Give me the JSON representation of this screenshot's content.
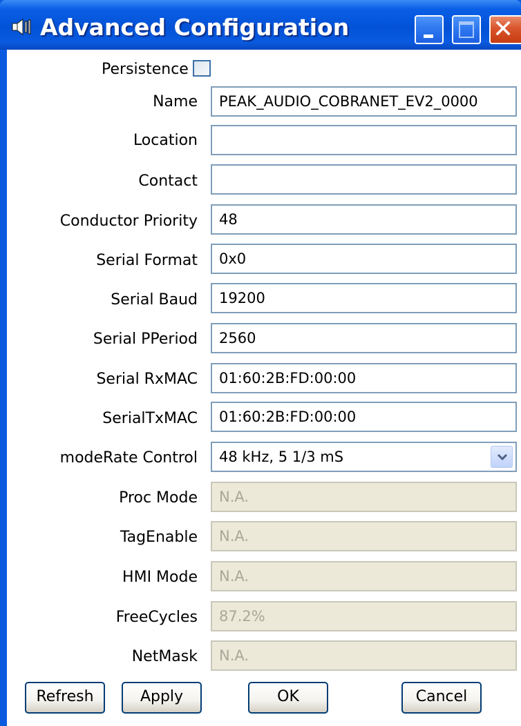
{
  "window": {
    "title": "Advanced Configuration",
    "title_icon": "speaker-icon"
  },
  "titlebar_buttons": {
    "minimize_icon": "minimize-icon",
    "maximize_icon": "maximize-icon",
    "close_icon": "close-icon"
  },
  "persistence": {
    "label": "Persistence",
    "checked": false
  },
  "fields": {
    "name": {
      "label": "Name",
      "value": "PEAK_AUDIO_COBRANET_EV2_0000"
    },
    "location": {
      "label": "Location",
      "value": ""
    },
    "contact": {
      "label": "Contact",
      "value": ""
    },
    "conductor_priority": {
      "label": "Conductor Priority",
      "value": "48"
    },
    "serial_format": {
      "label": "Serial Format",
      "value": "0x0"
    },
    "serial_baud": {
      "label": "Serial Baud",
      "value": "19200"
    },
    "serial_pperiod": {
      "label": "Serial PPeriod",
      "value": "2560"
    },
    "serial_rxmac": {
      "label": "Serial RxMAC",
      "value": "01:60:2B:FD:00:00"
    },
    "serial_txmac": {
      "label": "SerialTxMAC",
      "value": "01:60:2B:FD:00:00"
    },
    "moderate_control": {
      "label": "modeRate Control",
      "value": "48 kHz, 5 1/3 mS",
      "icon": "chevron-down-icon"
    },
    "proc_mode": {
      "label": "Proc Mode",
      "value": "N.A."
    },
    "tag_enable": {
      "label": "TagEnable",
      "value": "N.A."
    },
    "hmi_mode": {
      "label": "HMI Mode",
      "value": "N.A."
    },
    "free_cycles": {
      "label": "FreeCycles",
      "value": "87.2%"
    },
    "netmask": {
      "label": "NetMask",
      "value": "N.A."
    }
  },
  "buttons": {
    "refresh": "Refresh",
    "apply": "Apply",
    "ok": "OK",
    "cancel": "Cancel"
  },
  "colors": {
    "titlebar": "#0a5be0",
    "disabled_field": "#ece9d8",
    "field_border": "#7f9db9",
    "close_button": "#d9542c"
  }
}
